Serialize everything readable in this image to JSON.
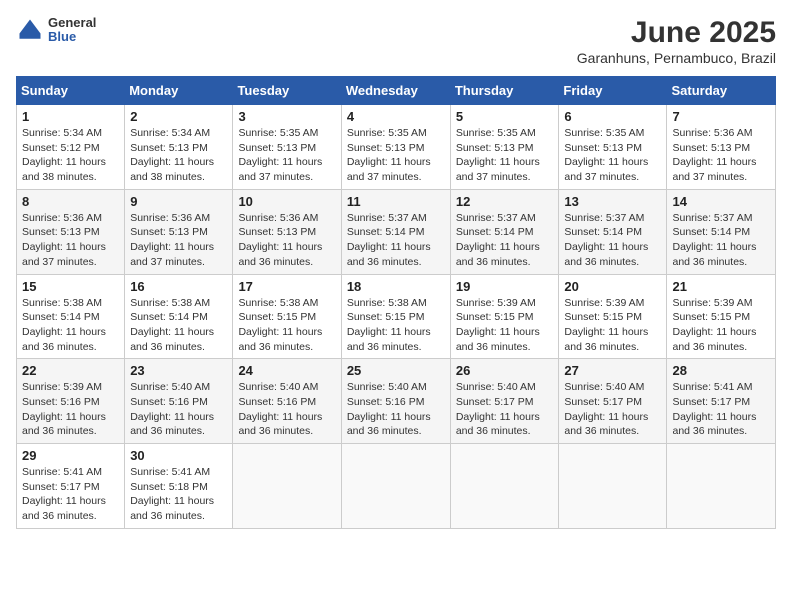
{
  "header": {
    "logo_general": "General",
    "logo_blue": "Blue",
    "title": "June 2025",
    "subtitle": "Garanhuns, Pernambuco, Brazil"
  },
  "calendar": {
    "days_of_week": [
      "Sunday",
      "Monday",
      "Tuesday",
      "Wednesday",
      "Thursday",
      "Friday",
      "Saturday"
    ],
    "weeks": [
      [
        {
          "day": "",
          "info": ""
        },
        {
          "day": "2",
          "info": "Sunrise: 5:34 AM\nSunset: 5:13 PM\nDaylight: 11 hours\nand 38 minutes."
        },
        {
          "day": "3",
          "info": "Sunrise: 5:35 AM\nSunset: 5:13 PM\nDaylight: 11 hours\nand 37 minutes."
        },
        {
          "day": "4",
          "info": "Sunrise: 5:35 AM\nSunset: 5:13 PM\nDaylight: 11 hours\nand 37 minutes."
        },
        {
          "day": "5",
          "info": "Sunrise: 5:35 AM\nSunset: 5:13 PM\nDaylight: 11 hours\nand 37 minutes."
        },
        {
          "day": "6",
          "info": "Sunrise: 5:35 AM\nSunset: 5:13 PM\nDaylight: 11 hours\nand 37 minutes."
        },
        {
          "day": "7",
          "info": "Sunrise: 5:36 AM\nSunset: 5:13 PM\nDaylight: 11 hours\nand 37 minutes."
        }
      ],
      [
        {
          "day": "1",
          "info": "Sunrise: 5:34 AM\nSunset: 5:12 PM\nDaylight: 11 hours\nand 38 minutes."
        },
        {
          "day": "9",
          "info": "Sunrise: 5:36 AM\nSunset: 5:13 PM\nDaylight: 11 hours\nand 37 minutes."
        },
        {
          "day": "10",
          "info": "Sunrise: 5:36 AM\nSunset: 5:13 PM\nDaylight: 11 hours\nand 36 minutes."
        },
        {
          "day": "11",
          "info": "Sunrise: 5:37 AM\nSunset: 5:14 PM\nDaylight: 11 hours\nand 36 minutes."
        },
        {
          "day": "12",
          "info": "Sunrise: 5:37 AM\nSunset: 5:14 PM\nDaylight: 11 hours\nand 36 minutes."
        },
        {
          "day": "13",
          "info": "Sunrise: 5:37 AM\nSunset: 5:14 PM\nDaylight: 11 hours\nand 36 minutes."
        },
        {
          "day": "14",
          "info": "Sunrise: 5:37 AM\nSunset: 5:14 PM\nDaylight: 11 hours\nand 36 minutes."
        }
      ],
      [
        {
          "day": "8",
          "info": "Sunrise: 5:36 AM\nSunset: 5:13 PM\nDaylight: 11 hours\nand 37 minutes."
        },
        {
          "day": "16",
          "info": "Sunrise: 5:38 AM\nSunset: 5:14 PM\nDaylight: 11 hours\nand 36 minutes."
        },
        {
          "day": "17",
          "info": "Sunrise: 5:38 AM\nSunset: 5:15 PM\nDaylight: 11 hours\nand 36 minutes."
        },
        {
          "day": "18",
          "info": "Sunrise: 5:38 AM\nSunset: 5:15 PM\nDaylight: 11 hours\nand 36 minutes."
        },
        {
          "day": "19",
          "info": "Sunrise: 5:39 AM\nSunset: 5:15 PM\nDaylight: 11 hours\nand 36 minutes."
        },
        {
          "day": "20",
          "info": "Sunrise: 5:39 AM\nSunset: 5:15 PM\nDaylight: 11 hours\nand 36 minutes."
        },
        {
          "day": "21",
          "info": "Sunrise: 5:39 AM\nSunset: 5:15 PM\nDaylight: 11 hours\nand 36 minutes."
        }
      ],
      [
        {
          "day": "15",
          "info": "Sunrise: 5:38 AM\nSunset: 5:14 PM\nDaylight: 11 hours\nand 36 minutes."
        },
        {
          "day": "23",
          "info": "Sunrise: 5:40 AM\nSunset: 5:16 PM\nDaylight: 11 hours\nand 36 minutes."
        },
        {
          "day": "24",
          "info": "Sunrise: 5:40 AM\nSunset: 5:16 PM\nDaylight: 11 hours\nand 36 minutes."
        },
        {
          "day": "25",
          "info": "Sunrise: 5:40 AM\nSunset: 5:16 PM\nDaylight: 11 hours\nand 36 minutes."
        },
        {
          "day": "26",
          "info": "Sunrise: 5:40 AM\nSunset: 5:17 PM\nDaylight: 11 hours\nand 36 minutes."
        },
        {
          "day": "27",
          "info": "Sunrise: 5:40 AM\nSunset: 5:17 PM\nDaylight: 11 hours\nand 36 minutes."
        },
        {
          "day": "28",
          "info": "Sunrise: 5:41 AM\nSunset: 5:17 PM\nDaylight: 11 hours\nand 36 minutes."
        }
      ],
      [
        {
          "day": "22",
          "info": "Sunrise: 5:39 AM\nSunset: 5:16 PM\nDaylight: 11 hours\nand 36 minutes."
        },
        {
          "day": "30",
          "info": "Sunrise: 5:41 AM\nSunset: 5:18 PM\nDaylight: 11 hours\nand 36 minutes."
        },
        {
          "day": "",
          "info": ""
        },
        {
          "day": "",
          "info": ""
        },
        {
          "day": "",
          "info": ""
        },
        {
          "day": "",
          "info": ""
        },
        {
          "day": "",
          "info": ""
        }
      ],
      [
        {
          "day": "29",
          "info": "Sunrise: 5:41 AM\nSunset: 5:17 PM\nDaylight: 11 hours\nand 36 minutes."
        },
        {
          "day": "",
          "info": ""
        },
        {
          "day": "",
          "info": ""
        },
        {
          "day": "",
          "info": ""
        },
        {
          "day": "",
          "info": ""
        },
        {
          "day": "",
          "info": ""
        },
        {
          "day": "",
          "info": ""
        }
      ]
    ]
  }
}
